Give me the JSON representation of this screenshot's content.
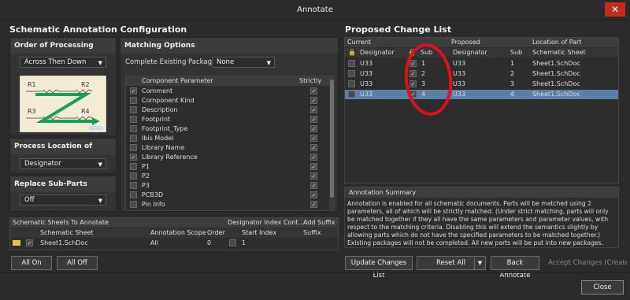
{
  "window": {
    "title": "Annotate",
    "close": "✕"
  },
  "left": {
    "title": "Schematic Annotation Configuration",
    "order": {
      "header": "Order of Processing",
      "value": "Across Then Down",
      "labels": [
        "R1",
        "R2",
        "R3",
        "R4"
      ]
    },
    "location": {
      "header": "Process Location of",
      "value": "Designator"
    },
    "replace": {
      "header": "Replace Sub-Parts",
      "value": "Off"
    },
    "matching": {
      "header": "Matching Options",
      "complete_label": "Complete Existing Packages",
      "complete_value": "None",
      "col_param": "Component Parameter",
      "col_strictly": "Strictly",
      "params": [
        {
          "name": "Comment",
          "checked": true
        },
        {
          "name": "Component Kind",
          "checked": false
        },
        {
          "name": "Description",
          "checked": false
        },
        {
          "name": "Footprint",
          "checked": false
        },
        {
          "name": "Footprint_Type",
          "checked": false
        },
        {
          "name": "Ibis Model",
          "checked": false
        },
        {
          "name": "Library Name",
          "checked": false
        },
        {
          "name": "Library Reference",
          "checked": true
        },
        {
          "name": "P1",
          "checked": false
        },
        {
          "name": "P2",
          "checked": false
        },
        {
          "name": "P3",
          "checked": false
        },
        {
          "name": "PCB3D",
          "checked": false
        },
        {
          "name": "Pin Info",
          "checked": false
        }
      ]
    },
    "sheets": {
      "header": "Schematic Sheets To Annotate",
      "col_dic": "Designator Index Cont...",
      "col_suffix": "Add Suffix",
      "col_sheet": "Schematic Sheet",
      "col_scope": "Annotation Scope",
      "col_order": "Order",
      "col_start": "Start Index",
      "col_suffix2": "Suffix",
      "row": {
        "sheet": "Sheet1.SchDoc",
        "scope": "All",
        "order": "0",
        "start": "1",
        "suffix": ""
      }
    },
    "all_on": "All On",
    "all_off": "All Off"
  },
  "right": {
    "title": "Proposed Change List",
    "group_current": "Current",
    "group_proposed": "Proposed",
    "group_location": "Location of Part",
    "cols": {
      "designator": "Designator",
      "sub": "Sub",
      "designator2": "Designator",
      "sub2": "Sub",
      "sheet": "Schematic Sheet"
    },
    "rows": [
      {
        "cur": "U33",
        "sub": "1",
        "prop": "U33",
        "psub": "1",
        "sheet": "Sheet1.SchDoc",
        "selected": false
      },
      {
        "cur": "U33",
        "sub": "2",
        "prop": "U33",
        "psub": "2",
        "sheet": "Sheet1.SchDoc",
        "selected": false
      },
      {
        "cur": "U33",
        "sub": "3",
        "prop": "U33",
        "psub": "3",
        "sheet": "Sheet1.SchDoc",
        "selected": false
      },
      {
        "cur": "U33",
        "sub": "4",
        "prop": "U33",
        "psub": "4",
        "sheet": "Sheet1.SchDoc",
        "selected": true
      }
    ],
    "summary_title": "Annotation Summary",
    "summary": "Annotation is enabled for all schematic documents. Parts will be matched using 2 parameters, all of which will be strictly matched. (Under strict matching, parts will only be matched together if they all have the same parameters and parameter values, with respect to the matching criteria. Disabling this will extend the semantics slightly by allowing parts which do not have the specified parameters to be matched together.) Existing packages will not be completed. All new parts will be put into new packages."
  },
  "buttons": {
    "update": "Update Changes List",
    "reset": "Reset All",
    "back": "Back Annotate",
    "accept": "Accept Changes (Create",
    "close": "Close"
  },
  "colors": {
    "selected_row": "#5a7fa8",
    "annotation": "#e0101a",
    "close_bg": "#c42b1c"
  }
}
